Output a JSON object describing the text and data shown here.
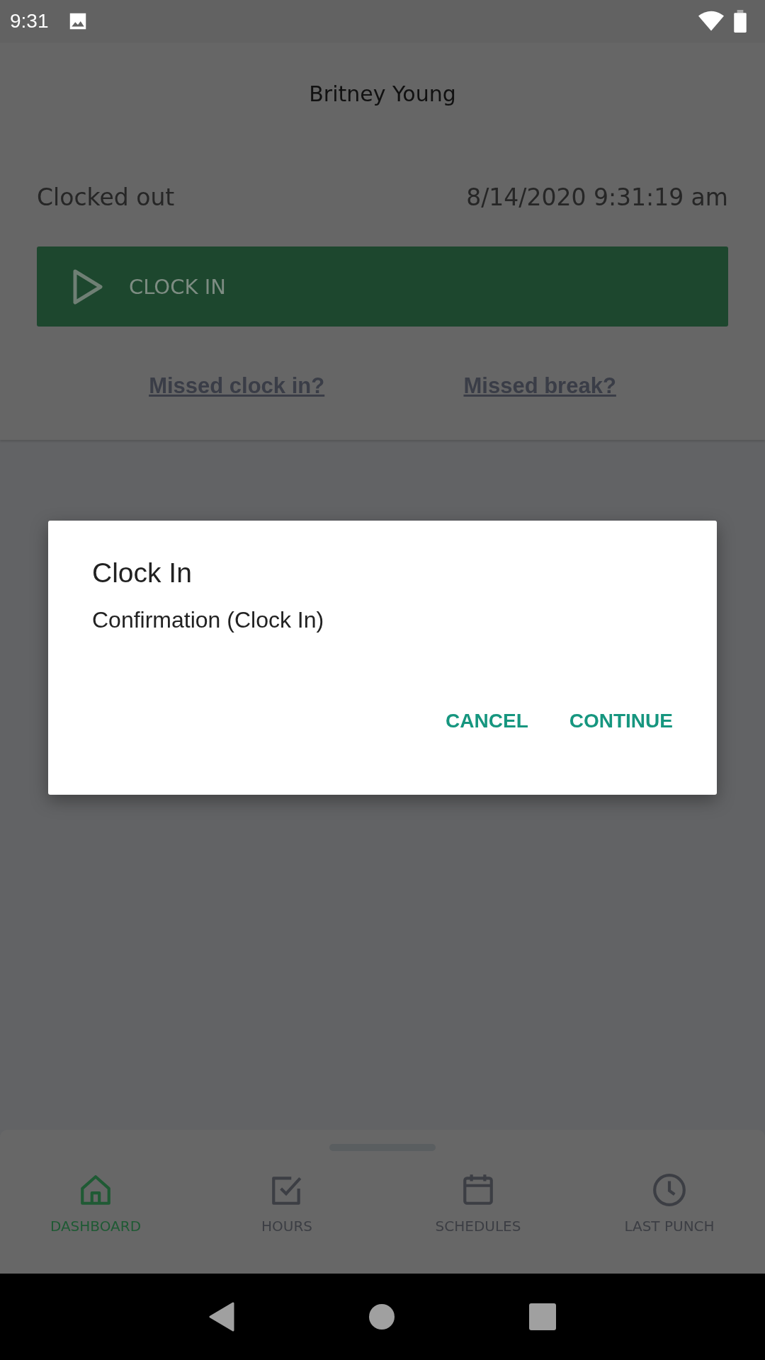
{
  "status_bar": {
    "time": "9:31"
  },
  "header": {
    "name": "Britney Young",
    "status": "Clocked out",
    "datetime": "8/14/2020 9:31:19 am",
    "clock_button": "CLOCK IN",
    "links": [
      "Missed clock in?",
      "Missed break?"
    ]
  },
  "dialog": {
    "title": "Clock In",
    "message": "Confirmation (Clock In)",
    "buttons": [
      "CANCEL",
      "CONTINUE"
    ]
  },
  "bottom_nav": [
    {
      "label": "DASHBOARD",
      "kind": "home",
      "selected": true
    },
    {
      "label": "HOURS",
      "kind": "check",
      "selected": false
    },
    {
      "label": "SCHEDULES",
      "kind": "calendar",
      "selected": false
    },
    {
      "label": "LAST PUNCH",
      "kind": "clock",
      "selected": false
    }
  ]
}
